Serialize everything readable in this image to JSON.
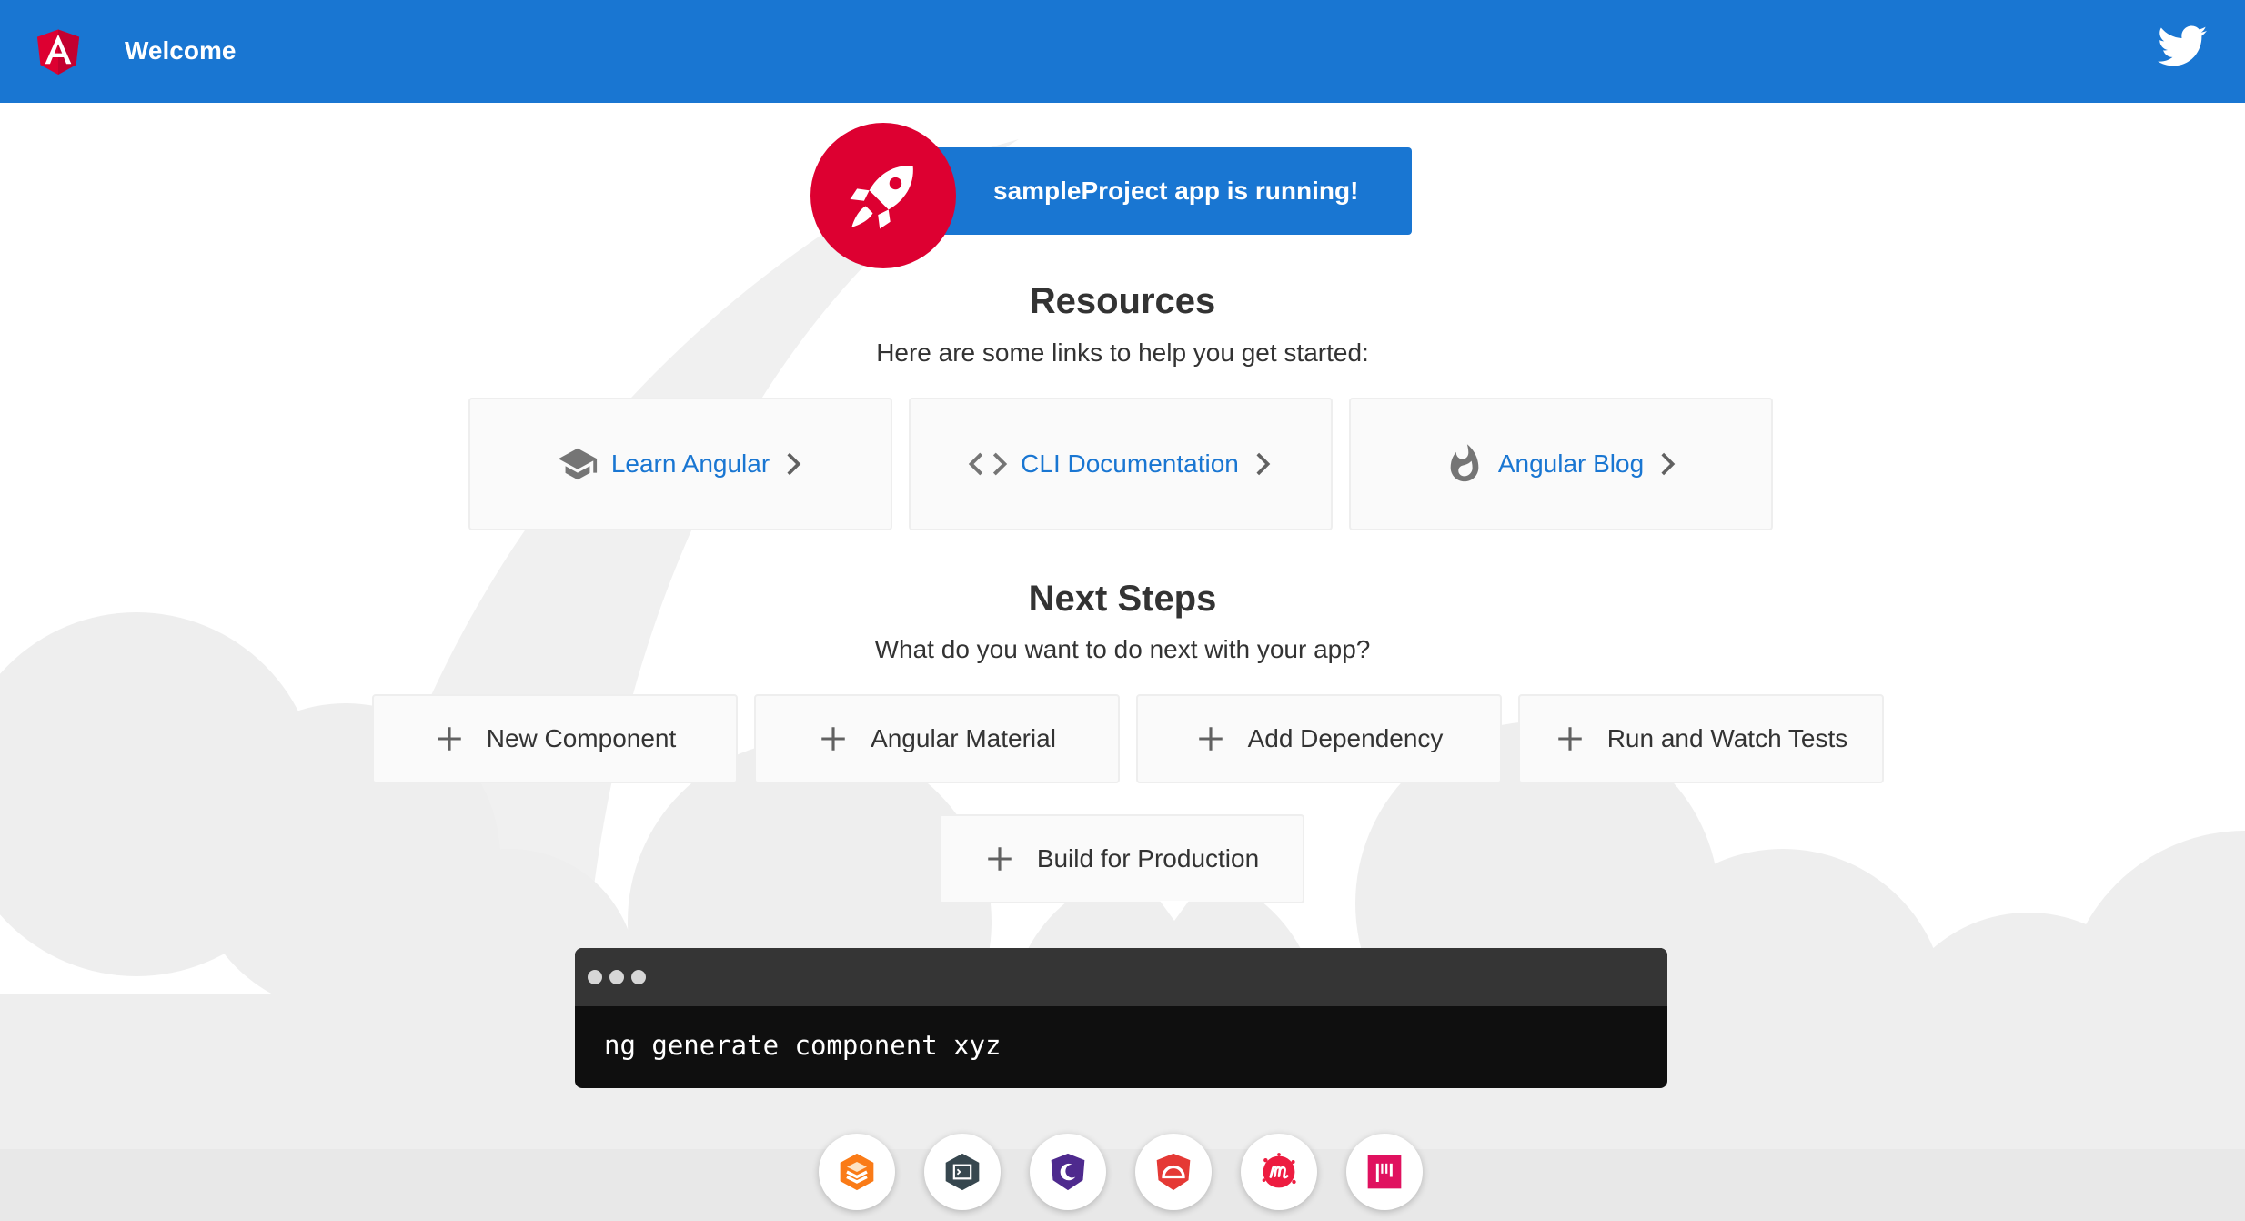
{
  "toolbar": {
    "title": "Welcome",
    "logo_icon": "angular-logo-icon",
    "twitter_icon": "twitter-icon"
  },
  "banner": {
    "text": "sampleProject app is running!",
    "icon": "rocket-icon"
  },
  "resources": {
    "title": "Resources",
    "subtitle": "Here are some links to help you get started:",
    "links": [
      {
        "label": "Learn Angular",
        "icon": "graduation-cap-icon"
      },
      {
        "label": "CLI Documentation",
        "icon": "code-brackets-icon"
      },
      {
        "label": "Angular Blog",
        "icon": "flame-icon"
      }
    ]
  },
  "next_steps": {
    "title": "Next Steps",
    "subtitle": "What do you want to do next with your app?",
    "actions": [
      {
        "label": "New Component"
      },
      {
        "label": "Angular Material"
      },
      {
        "label": "Add Dependency"
      },
      {
        "label": "Run and Watch Tests"
      },
      {
        "label": "Build for Production"
      }
    ]
  },
  "terminal": {
    "command": "ng generate component xyz"
  },
  "footer_links": [
    {
      "icon": "animations-icon"
    },
    {
      "icon": "cli-icon"
    },
    {
      "icon": "augury-icon"
    },
    {
      "icon": "protractor-icon"
    },
    {
      "icon": "meetup-icon"
    },
    {
      "icon": "discord-icon"
    }
  ],
  "colors": {
    "toolbar": "#1976d2",
    "link": "#1976d2",
    "angular_red": "#dd0031",
    "card_bg": "#fafafa",
    "terminal_bg": "#0f0f0f"
  }
}
